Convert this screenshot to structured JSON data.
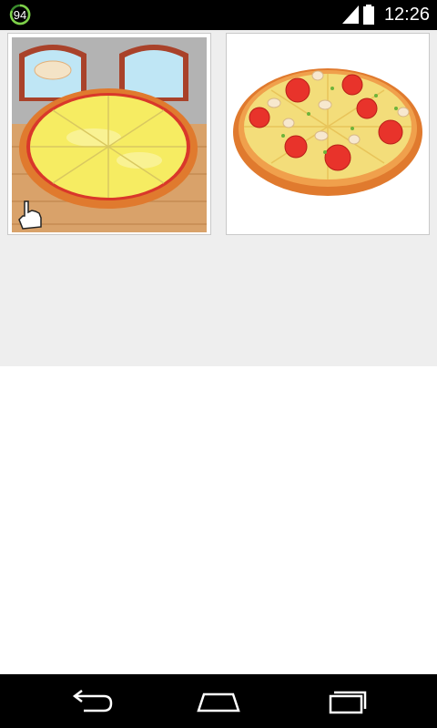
{
  "status_bar": {
    "notification_count": "94",
    "time": "12:26",
    "icons": [
      "signal-icon",
      "battery-icon"
    ]
  },
  "gallery": {
    "items": [
      {
        "name": "cheese-pizza-kitchen-thumbnail"
      },
      {
        "name": "tomato-mushroom-pizza-thumbnail"
      }
    ]
  },
  "navigation": {
    "buttons": [
      "back-icon",
      "home-icon",
      "recents-icon"
    ]
  },
  "colors": {
    "background": "#eeeeee",
    "status_bar": "#000000",
    "crust": "#e07a2e",
    "cheese": "#f6ec62",
    "tomato": "#e8332b"
  }
}
